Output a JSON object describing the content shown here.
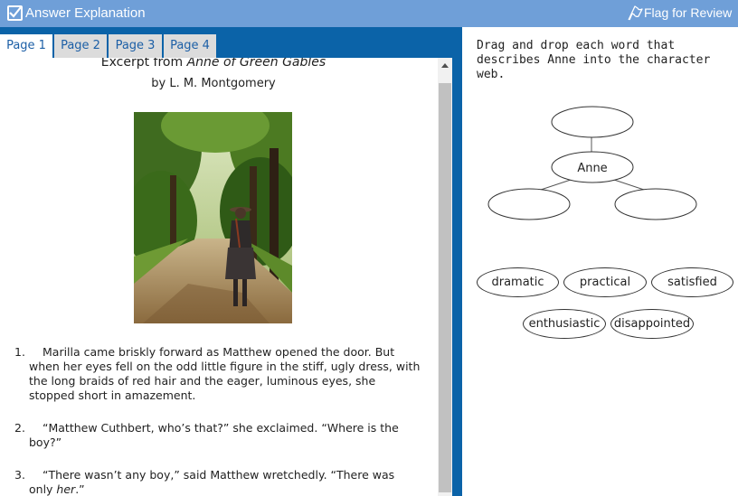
{
  "header": {
    "title": "Answer Explanation",
    "flag_label": "Flag for Review"
  },
  "tabs": [
    {
      "label": "Page 1"
    },
    {
      "label": "Page 2"
    },
    {
      "label": "Page 3"
    },
    {
      "label": "Page 4"
    }
  ],
  "passage": {
    "title_prefix": "Excerpt from ",
    "title_book": "Anne of Green Gables",
    "author": "by L. M. Montgomery",
    "paragraphs": [
      {
        "num": "1.",
        "text": "Marilla came briskly forward as Matthew opened the door. But when her eyes fell on the odd little figure in the stiff, ugly dress, with the long braids of red hair and the eager, luminous eyes, she stopped short in amazement."
      },
      {
        "num": "2.",
        "text": "“Matthew Cuthbert, who’s that?” she exclaimed. “Where is the boy?”"
      },
      {
        "num": "3.",
        "text_before": "“There wasn’t any boy,” said Matthew wretchedly. “There was only ",
        "text_italic": "her",
        "text_after": ".”"
      }
    ]
  },
  "question": {
    "instructions": "Drag and drop each word that describes Anne into the character web."
  },
  "character_web": {
    "center_label": "Anne",
    "empty_slots": 3
  },
  "word_bank": [
    {
      "label": "dramatic"
    },
    {
      "label": "practical"
    },
    {
      "label": "satisfied"
    },
    {
      "label": "enthusiastic"
    },
    {
      "label": "disappointed"
    }
  ]
}
